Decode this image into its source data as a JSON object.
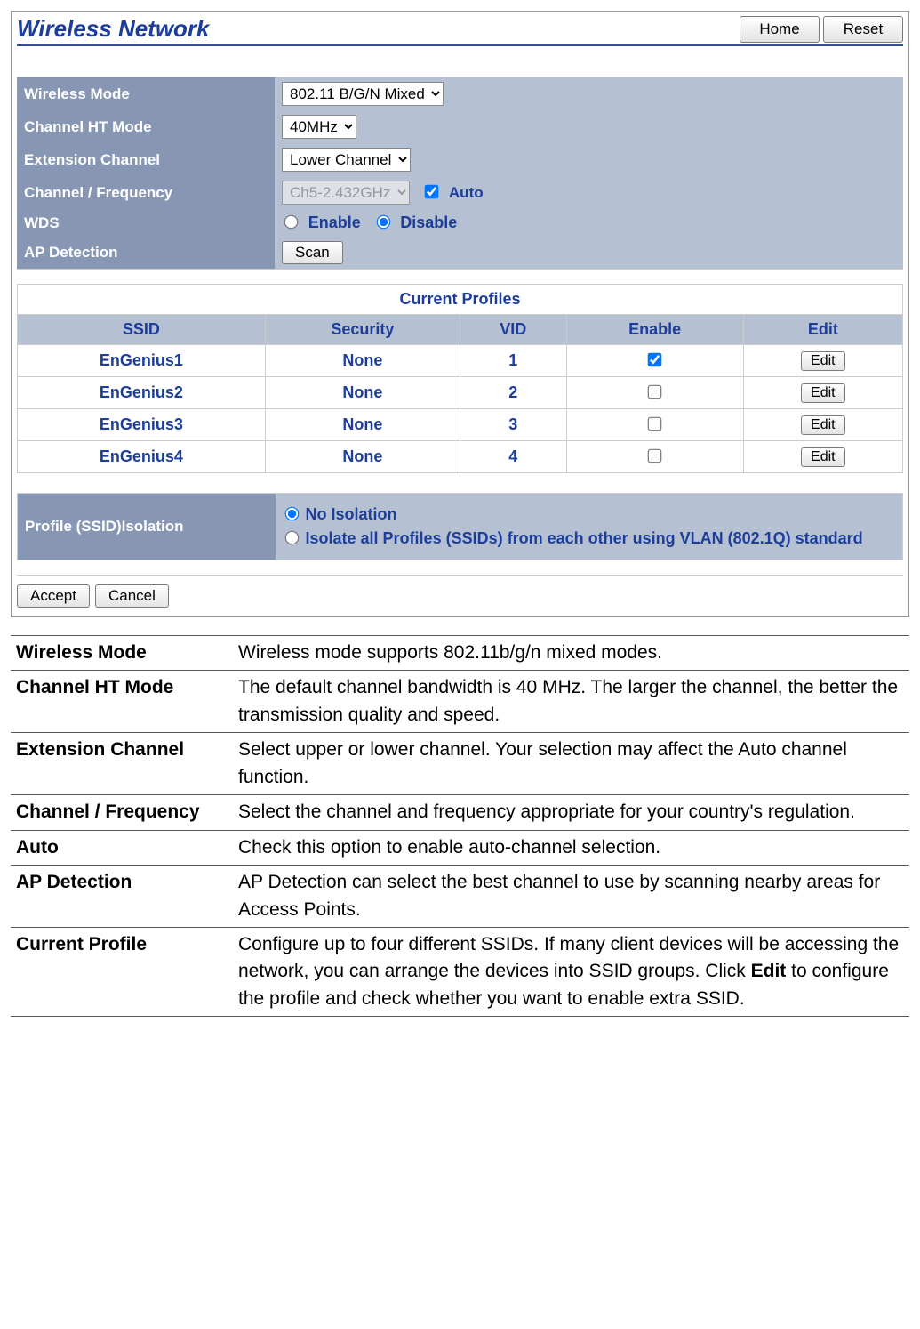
{
  "header": {
    "title": "Wireless Network",
    "home": "Home",
    "reset": "Reset"
  },
  "settings": {
    "wireless_mode_label": "Wireless Mode",
    "wireless_mode_value": "802.11 B/G/N Mixed",
    "ht_mode_label": "Channel HT Mode",
    "ht_mode_value": "40MHz",
    "ext_channel_label": "Extension Channel",
    "ext_channel_value": "Lower Channel",
    "chan_freq_label": "Channel / Frequency",
    "chan_freq_value": "Ch5-2.432GHz",
    "auto_label": "Auto",
    "wds_label": "WDS",
    "wds_enable": "Enable",
    "wds_disable": "Disable",
    "ap_detection_label": "AP Detection",
    "scan": "Scan"
  },
  "profiles": {
    "title": "Current Profiles",
    "cols": {
      "ssid": "SSID",
      "security": "Security",
      "vid": "VID",
      "enable": "Enable",
      "edit": "Edit"
    },
    "edit_btn": "Edit",
    "rows": [
      {
        "ssid": "EnGenius1",
        "security": "None",
        "vid": "1",
        "enabled": true
      },
      {
        "ssid": "EnGenius2",
        "security": "None",
        "vid": "2",
        "enabled": false
      },
      {
        "ssid": "EnGenius3",
        "security": "None",
        "vid": "3",
        "enabled": false
      },
      {
        "ssid": "EnGenius4",
        "security": "None",
        "vid": "4",
        "enabled": false
      }
    ]
  },
  "isolation": {
    "label": "Profile (SSID)Isolation",
    "none": "No Isolation",
    "vlan": "Isolate all Profiles (SSIDs) from each other using VLAN (802.1Q) standard"
  },
  "actions": {
    "accept": "Accept",
    "cancel": "Cancel"
  },
  "desc": [
    {
      "term": "Wireless Mode",
      "text": "Wireless mode supports 802.11b/g/n mixed modes."
    },
    {
      "term": "Channel HT Mode",
      "text": "The default channel bandwidth is 40 MHz. The larger the channel, the better the transmission quality and speed."
    },
    {
      "term": "Extension Channel",
      "text": "Select upper or lower channel. Your selection may affect the Auto channel function."
    },
    {
      "term": "Channel / Frequency",
      "text": "Select the channel and frequency appropriate for your country's regulation."
    },
    {
      "term": "Auto",
      "text": "Check this option to enable auto-channel selection."
    },
    {
      "term": "AP Detection",
      "text": "AP Detection can select the best channel to use by scanning nearby areas for Access Points."
    },
    {
      "term": "Current Profile",
      "text": "Configure up to four different SSIDs. If many client devices will be accessing the network, you can arrange the devices into SSID groups. Click Edit to configure the profile and check whether you want to enable extra SSID.",
      "bold": "Edit"
    }
  ]
}
